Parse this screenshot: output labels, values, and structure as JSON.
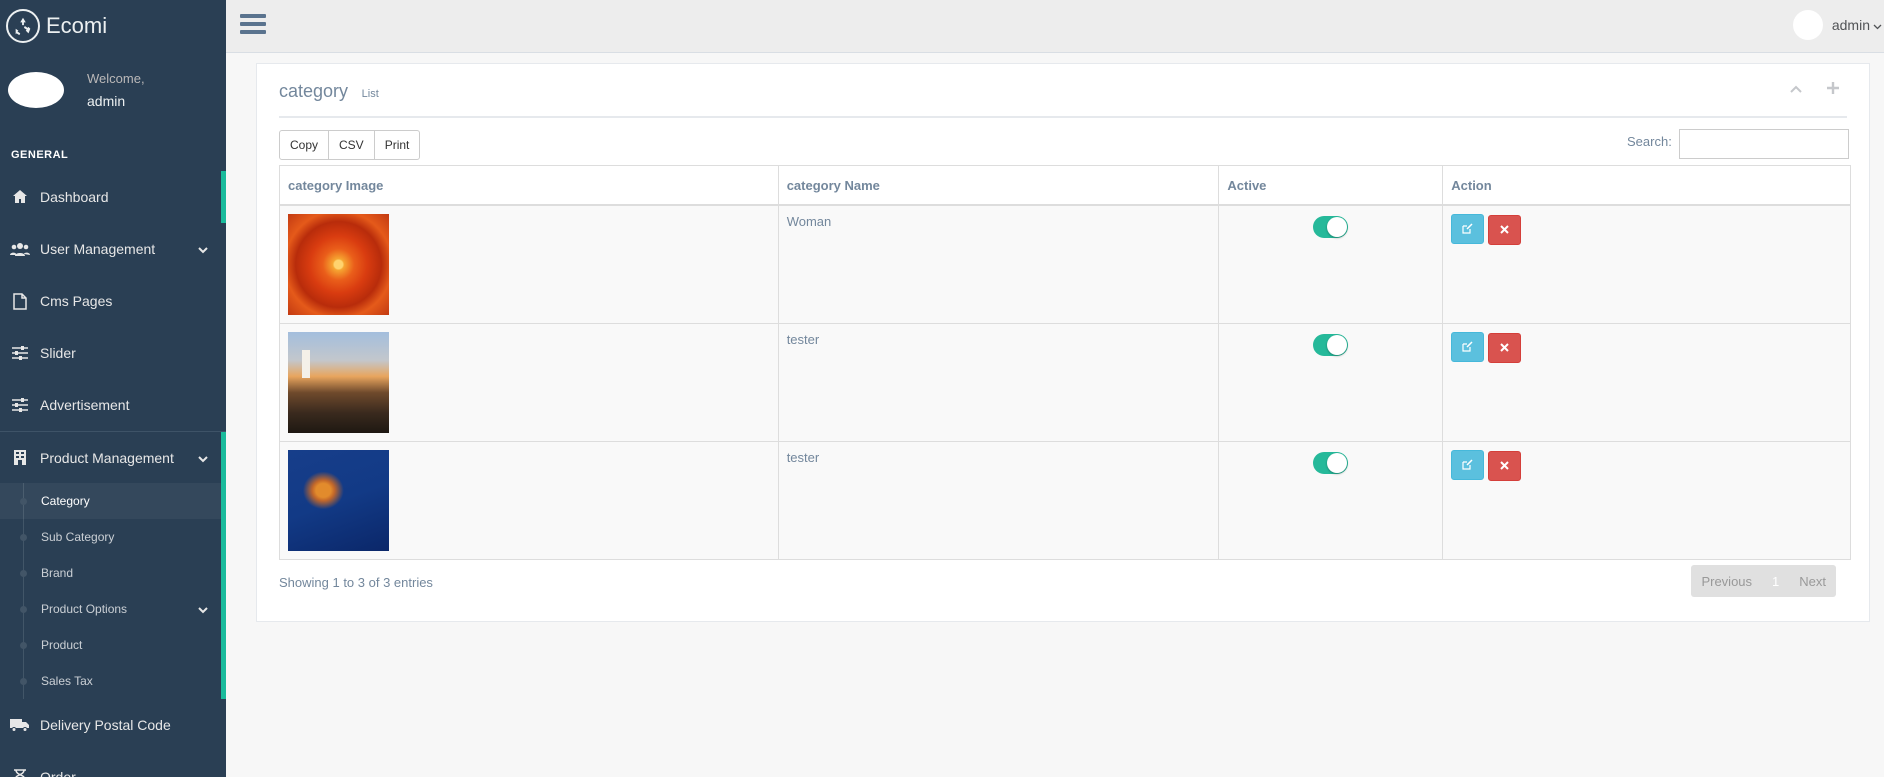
{
  "brand": {
    "title": "Ecomi",
    "icon": "recycle-icon"
  },
  "profile": {
    "welcome": "Welcome,",
    "name": "admin"
  },
  "sidebar": {
    "section_title": "GENERAL",
    "items": [
      {
        "label": "Dashboard",
        "icon": "home-icon"
      },
      {
        "label": "User Management",
        "icon": "users-icon"
      },
      {
        "label": "Cms Pages",
        "icon": "file-icon"
      },
      {
        "label": "Slider",
        "icon": "sliders-icon"
      },
      {
        "label": "Advertisement",
        "icon": "sliders-icon"
      },
      {
        "label": "Product Management",
        "icon": "building-icon"
      },
      {
        "label": "Delivery Postal Code",
        "icon": "truck-icon"
      },
      {
        "label": "Order",
        "icon": "hourglass-icon"
      }
    ],
    "children": [
      {
        "label": "Category"
      },
      {
        "label": "Sub Category"
      },
      {
        "label": "Brand"
      },
      {
        "label": "Product Options"
      },
      {
        "label": "Product"
      },
      {
        "label": "Sales Tax"
      }
    ]
  },
  "topnav": {
    "user": "admin"
  },
  "panel": {
    "title": "category",
    "subtitle": "List",
    "buttons": {
      "copy": "Copy",
      "csv": "CSV",
      "print": "Print"
    },
    "search_label": "Search:",
    "columns": [
      "category Image",
      "category Name",
      "Active",
      "Action"
    ],
    "rows": [
      {
        "name": "Woman",
        "active": true
      },
      {
        "name": "tester",
        "active": true
      },
      {
        "name": "tester",
        "active": true
      }
    ],
    "info": "Showing 1 to 3 of 3 entries",
    "pager": {
      "previous": "Previous",
      "page": "1",
      "next": "Next"
    }
  },
  "colors": {
    "sidebar": "#2A3F54",
    "accent": "#1ABB9C",
    "toggle": "#26B99A",
    "edit": "#5BC0DE",
    "delete": "#D9534F"
  }
}
